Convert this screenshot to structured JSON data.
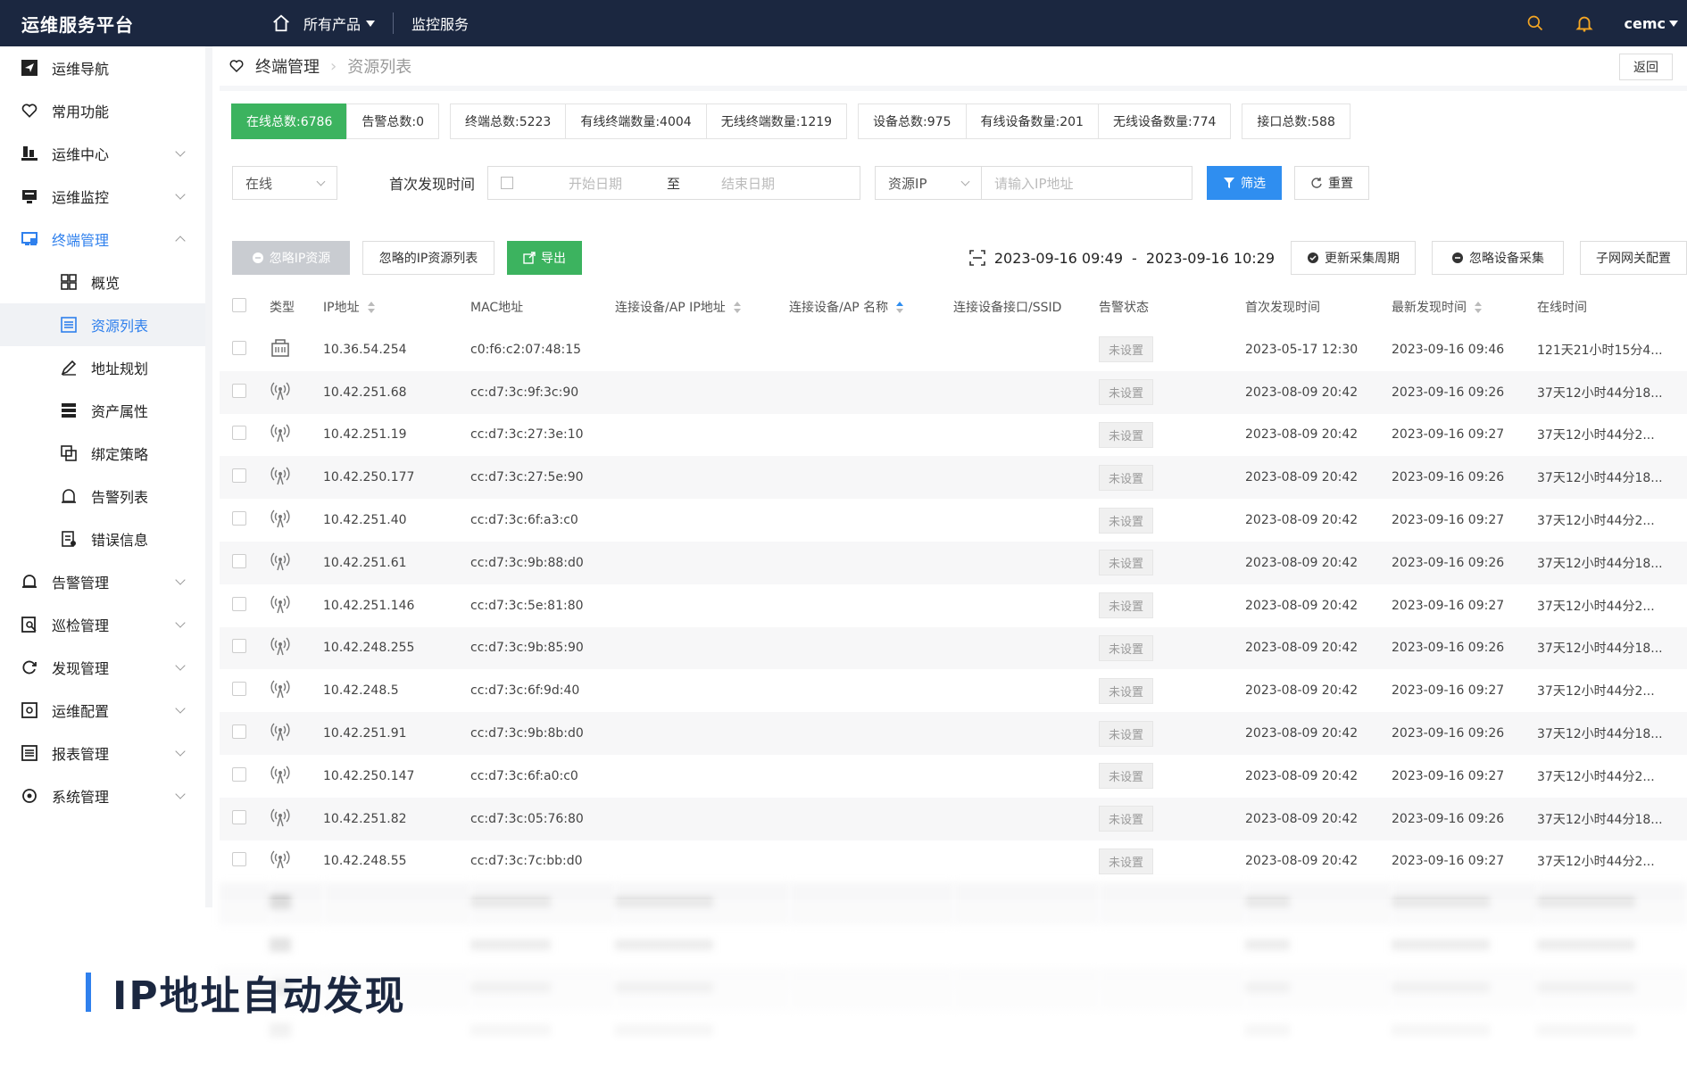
{
  "topbar": {
    "brand": "运维服务平台",
    "products": "所有产品",
    "monitor": "监控服务",
    "user": "cemc"
  },
  "sidebar": {
    "items": [
      {
        "label": "运维导航",
        "icon": "send-icon"
      },
      {
        "label": "常用功能",
        "icon": "heart-icon"
      },
      {
        "label": "运维中心",
        "icon": "ops-center-icon"
      },
      {
        "label": "运维监控",
        "icon": "monitor-icon"
      },
      {
        "label": "终端管理",
        "icon": "terminal-icon"
      }
    ],
    "sub_items": [
      {
        "label": "概览",
        "icon": "grid-icon"
      },
      {
        "label": "资源列表",
        "icon": "list-icon"
      },
      {
        "label": "地址规划",
        "icon": "pen-icon"
      },
      {
        "label": "资产属性",
        "icon": "server-icon"
      },
      {
        "label": "绑定策略",
        "icon": "bind-icon"
      },
      {
        "label": "告警列表",
        "icon": "alarm-list-icon"
      },
      {
        "label": "错误信息",
        "icon": "error-icon"
      }
    ],
    "items2": [
      {
        "label": "告警管理",
        "icon": "alarm-icon"
      },
      {
        "label": "巡检管理",
        "icon": "inspect-icon"
      },
      {
        "label": "发现管理",
        "icon": "discover-icon"
      },
      {
        "label": "运维配置",
        "icon": "config-icon"
      },
      {
        "label": "报表管理",
        "icon": "report-icon"
      },
      {
        "label": "系统管理",
        "icon": "system-icon"
      }
    ]
  },
  "breadcrumb": {
    "parent": "终端管理",
    "current": "资源列表",
    "back": "返回"
  },
  "stats": [
    "在线总数:6786",
    "告警总数:0",
    "终端总数:5223",
    "有线终端数量:4004",
    "无线终端数量:1219",
    "设备总数:975",
    "有线设备数量:201",
    "无线设备数量:774",
    "接口总数:588"
  ],
  "filters": {
    "status": "在线",
    "first_found_label": "首次发现时间",
    "start_placeholder": "开始日期",
    "to": "至",
    "end_placeholder": "结束日期",
    "ip_type": "资源IP",
    "ip_placeholder": "请输入IP地址",
    "filter_btn": "筛选",
    "reset_btn": "重置"
  },
  "actions": {
    "ignore_ip": "忽略IP资源",
    "ignored_list": "忽略的IP资源列表",
    "export": "导出",
    "time_start": "2023-09-16 09:49",
    "time_dash": "-",
    "time_end": "2023-09-16 10:29",
    "update_cycle": "更新采集周期",
    "ignore_collect": "忽略设备采集",
    "subnet_gw": "子网网关配置"
  },
  "table": {
    "headers": [
      "类型",
      "IP地址",
      "MAC地址",
      "连接设备/AP IP地址",
      "连接设备/AP 名称",
      "连接设备接口/SSID",
      "告警状态",
      "首次发现时间",
      "最新发现时间",
      "在线时间"
    ],
    "rows": [
      {
        "type": "wired",
        "ip": "10.36.54.254",
        "mac": "c0:f6:c2:07:48:15",
        "alarm": "未设置",
        "first": "2023-05-17 12:30",
        "latest": "2023-09-16 09:46",
        "online": "121天21小时15分4..."
      },
      {
        "type": "wireless",
        "ip": "10.42.251.68",
        "mac": "cc:d7:3c:9f:3c:90",
        "alarm": "未设置",
        "first": "2023-08-09 20:42",
        "latest": "2023-09-16 09:26",
        "online": "37天12小时44分18..."
      },
      {
        "type": "wireless",
        "ip": "10.42.251.19",
        "mac": "cc:d7:3c:27:3e:10",
        "alarm": "未设置",
        "first": "2023-08-09 20:42",
        "latest": "2023-09-16 09:27",
        "online": "37天12小时44分2..."
      },
      {
        "type": "wireless",
        "ip": "10.42.250.177",
        "mac": "cc:d7:3c:27:5e:90",
        "alarm": "未设置",
        "first": "2023-08-09 20:42",
        "latest": "2023-09-16 09:26",
        "online": "37天12小时44分18..."
      },
      {
        "type": "wireless",
        "ip": "10.42.251.40",
        "mac": "cc:d7:3c:6f:a3:c0",
        "alarm": "未设置",
        "first": "2023-08-09 20:42",
        "latest": "2023-09-16 09:27",
        "online": "37天12小时44分2..."
      },
      {
        "type": "wireless",
        "ip": "10.42.251.61",
        "mac": "cc:d7:3c:9b:88:d0",
        "alarm": "未设置",
        "first": "2023-08-09 20:42",
        "latest": "2023-09-16 09:26",
        "online": "37天12小时44分18..."
      },
      {
        "type": "wireless",
        "ip": "10.42.251.146",
        "mac": "cc:d7:3c:5e:81:80",
        "alarm": "未设置",
        "first": "2023-08-09 20:42",
        "latest": "2023-09-16 09:27",
        "online": "37天12小时44分2..."
      },
      {
        "type": "wireless",
        "ip": "10.42.248.255",
        "mac": "cc:d7:3c:9b:85:90",
        "alarm": "未设置",
        "first": "2023-08-09 20:42",
        "latest": "2023-09-16 09:26",
        "online": "37天12小时44分18..."
      },
      {
        "type": "wireless",
        "ip": "10.42.248.5",
        "mac": "cc:d7:3c:6f:9d:40",
        "alarm": "未设置",
        "first": "2023-08-09 20:42",
        "latest": "2023-09-16 09:27",
        "online": "37天12小时44分2..."
      },
      {
        "type": "wireless",
        "ip": "10.42.251.91",
        "mac": "cc:d7:3c:9b:8b:d0",
        "alarm": "未设置",
        "first": "2023-08-09 20:42",
        "latest": "2023-09-16 09:26",
        "online": "37天12小时44分18..."
      },
      {
        "type": "wireless",
        "ip": "10.42.250.147",
        "mac": "cc:d7:3c:6f:a0:c0",
        "alarm": "未设置",
        "first": "2023-08-09 20:42",
        "latest": "2023-09-16 09:27",
        "online": "37天12小时44分2..."
      },
      {
        "type": "wireless",
        "ip": "10.42.251.82",
        "mac": "cc:d7:3c:05:76:80",
        "alarm": "未设置",
        "first": "2023-08-09 20:42",
        "latest": "2023-09-16 09:26",
        "online": "37天12小时44分18..."
      },
      {
        "type": "wireless",
        "ip": "10.42.248.55",
        "mac": "cc:d7:3c:7c:bb:d0",
        "alarm": "未设置",
        "first": "2023-08-09 20:42",
        "latest": "2023-09-16 09:27",
        "online": "37天12小时44分2..."
      }
    ]
  },
  "caption": "IP地址自动发现",
  "colors": {
    "topbar": "#1b2740",
    "accent": "#2f80ed",
    "green": "#3cb35f",
    "blue_btn": "#2f8ef0"
  }
}
